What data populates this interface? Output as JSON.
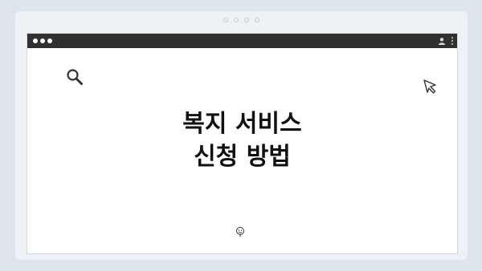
{
  "title": {
    "line1": "복지 서비스",
    "line2": "신청 방법"
  },
  "icons": {
    "search": "search-icon",
    "cursor": "cursor-icon",
    "profile": "profile-icon",
    "menu": "kebab-menu-icon",
    "emoji": "smiley-icon"
  },
  "colors": {
    "background": "#dfe5ed",
    "titlebar": "#303030",
    "text": "#111111"
  }
}
